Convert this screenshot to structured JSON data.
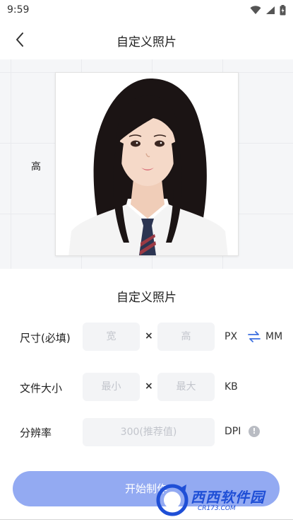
{
  "status_bar": {
    "time": "9:59"
  },
  "nav": {
    "title": "自定义照片"
  },
  "preview": {
    "side_label": "高"
  },
  "form": {
    "title": "自定义照片",
    "size_row": {
      "label": "尺寸(必填)",
      "width_placeholder": "宽",
      "height_placeholder": "高",
      "times": "×",
      "unit_px": "PX",
      "unit_mm": "MM"
    },
    "file_row": {
      "label": "文件大小",
      "min_placeholder": "最小",
      "max_placeholder": "最大",
      "times": "×",
      "unit": "KB"
    },
    "dpi_row": {
      "label": "分辨率",
      "placeholder": "300(推荐值)",
      "unit": "DPI",
      "info_glyph": "!"
    },
    "start_label": "开始制作"
  },
  "watermark": {
    "text": "西西软件园",
    "sub": "CR173.COM"
  },
  "colors": {
    "accent": "#93aaf2",
    "swap": "#3b6fe0",
    "field_bg": "#f3f4f6",
    "grid_bg": "#f5f6f8"
  },
  "icons": [
    "wifi-icon",
    "signal-icon",
    "battery-icon",
    "back-arrow-icon",
    "swap-arrows-icon",
    "info-icon",
    "person-photo"
  ]
}
